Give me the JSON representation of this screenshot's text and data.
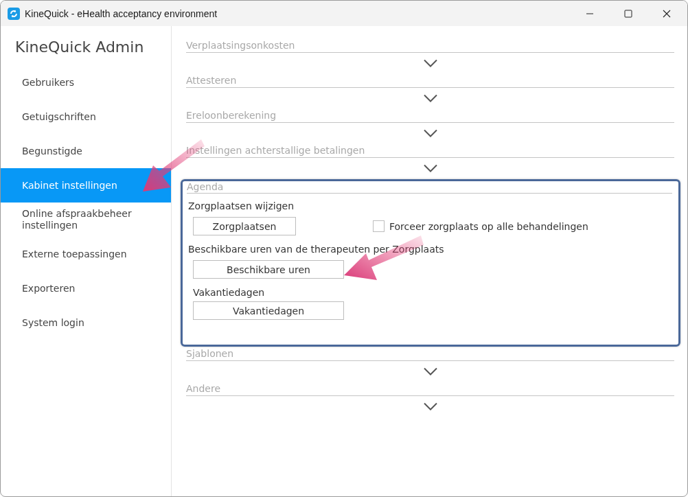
{
  "window": {
    "title": "KineQuick - eHealth acceptancy environment"
  },
  "sidebar": {
    "title": "KineQuick Admin",
    "items": [
      {
        "label": "Gebruikers",
        "selected": false
      },
      {
        "label": "Getuigschriften",
        "selected": false
      },
      {
        "label": "Begunstigde",
        "selected": false
      },
      {
        "label": "Kabinet instellingen",
        "selected": true
      },
      {
        "label": "Online afspraakbeheer instellingen",
        "selected": false
      },
      {
        "label": "Externe toepassingen",
        "selected": false
      },
      {
        "label": "Exporteren",
        "selected": false
      },
      {
        "label": "System login",
        "selected": false
      }
    ]
  },
  "sections": [
    {
      "title": "Verplaatsingsonkosten",
      "expanded": false
    },
    {
      "title": "Attesteren",
      "expanded": false
    },
    {
      "title": "Ereloonberekening",
      "expanded": false
    },
    {
      "title": "Instellingen achterstallige betalingen",
      "expanded": false
    },
    {
      "title": "Agenda",
      "expanded": true,
      "highlighted": true,
      "groups": [
        {
          "label": "Zorgplaatsen wijzigen",
          "button": "Zorgplaatsen",
          "checkbox": {
            "label": "Forceer zorgplaats op alle behandelingen",
            "checked": false
          }
        },
        {
          "label": "Beschikbare uren van de therapeuten per Zorgplaats",
          "button": "Beschikbare uren"
        },
        {
          "label": "Vakantiedagen",
          "button": "Vakantiedagen"
        }
      ]
    },
    {
      "title": "Sjablonen",
      "expanded": false
    },
    {
      "title": "Andere",
      "expanded": false
    }
  ]
}
